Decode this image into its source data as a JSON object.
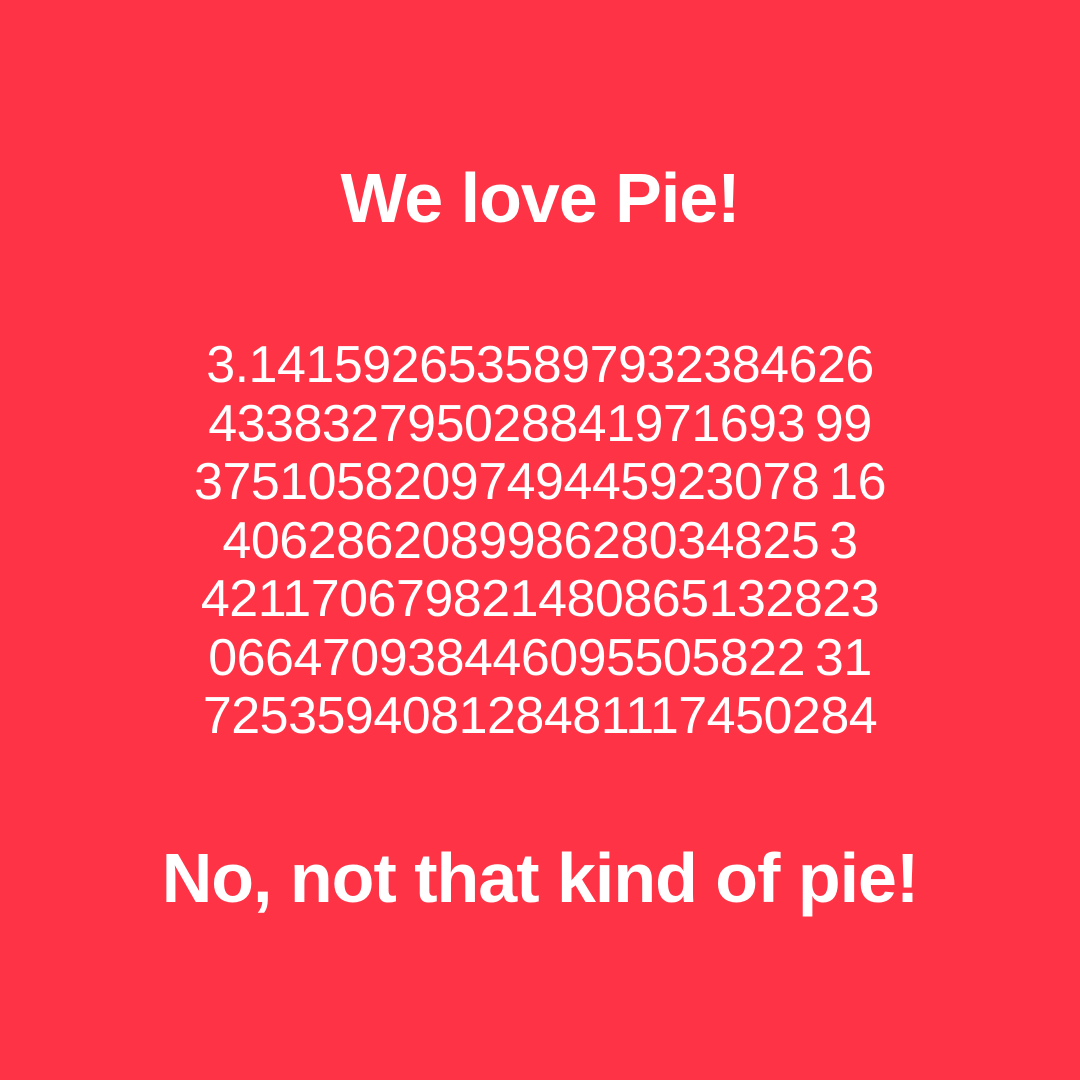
{
  "background_color": "#ff3346",
  "text_color": "#ffffff",
  "headline": "We love Pie!",
  "pi_lines": [
    "3.1415926535897932384626",
    "433832795028841971693 99",
    "3751058209749445923078 16",
    "406286208998628034825 3",
    "421170679821480865132823",
    "066470938446095505822 31",
    "725359408128481117450284"
  ],
  "footer": "No, not that kind of pie!"
}
